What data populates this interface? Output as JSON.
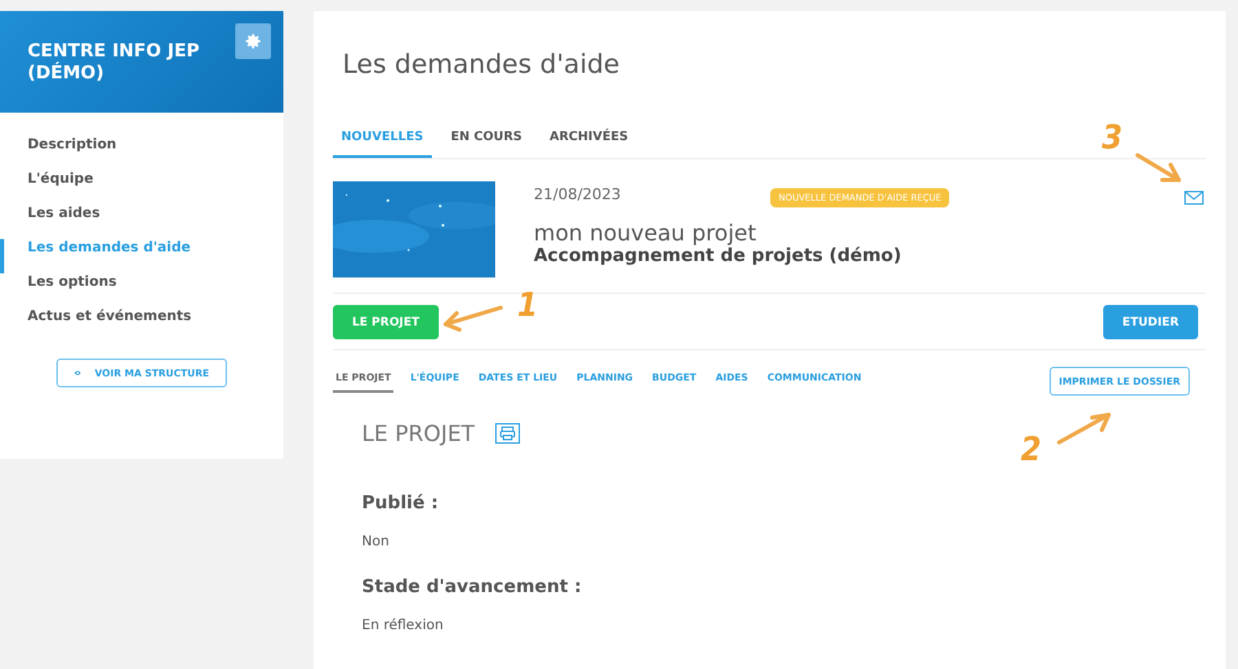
{
  "sidebar": {
    "title": "CENTRE INFO JEP (DÉMO)",
    "items": [
      {
        "label": "Description",
        "selected": false
      },
      {
        "label": "L'équipe",
        "selected": false
      },
      {
        "label": "Les aides",
        "selected": false
      },
      {
        "label": "Les demandes d'aide",
        "selected": true
      },
      {
        "label": "Les options",
        "selected": false
      },
      {
        "label": "Actus et événements",
        "selected": false
      }
    ],
    "button": "VOIR MA STRUCTURE"
  },
  "page_title": "Les demandes d'aide",
  "tabs": [
    {
      "label": "NOUVELLES",
      "selected": true
    },
    {
      "label": "EN COURS",
      "selected": false
    },
    {
      "label": "ARCHIVÉES",
      "selected": false
    }
  ],
  "request": {
    "date": "21/08/2023",
    "badge": "NOUVELLE DEMANDE D'AIDE REÇUE",
    "name": "mon nouveau projet",
    "program": "Accompagnement de projets (démo)",
    "project_button": "LE PROJET",
    "study_button": "ETUDIER"
  },
  "subtabs": [
    {
      "label": "LE PROJET",
      "selected": true
    },
    {
      "label": "L'ÉQUIPE",
      "selected": false
    },
    {
      "label": "DATES ET LIEU",
      "selected": false
    },
    {
      "label": "PLANNING",
      "selected": false
    },
    {
      "label": "BUDGET",
      "selected": false
    },
    {
      "label": "AIDES",
      "selected": false
    },
    {
      "label": "COMMUNICATION",
      "selected": false
    }
  ],
  "print_button": "IMPRIMER LE DOSSIER",
  "section_title": "LE PROJET",
  "fields": [
    {
      "label": "Publié :",
      "value": "Non"
    },
    {
      "label": "Stade d'avancement :",
      "value": "En réflexion"
    }
  ],
  "annotations": [
    "1",
    "2",
    "3"
  ]
}
